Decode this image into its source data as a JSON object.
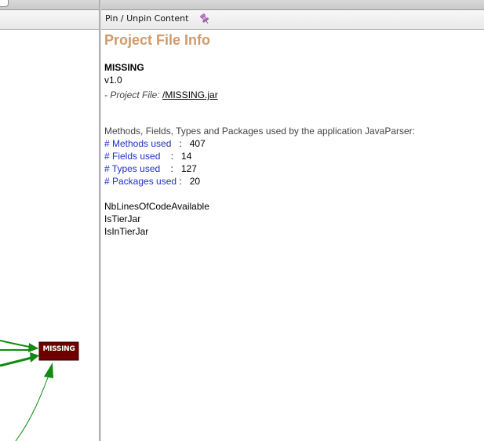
{
  "toolbar": {
    "pin_label": "Pin / Unpin Content",
    "pin_icon": "pushpin-icon"
  },
  "info": {
    "title": "Project File Info",
    "assembly_name": "MISSING",
    "version": "v1.0",
    "project_file_label": "- Project File: ",
    "project_file_link": "/MISSING.jar",
    "summary": "Methods, Fields, Types and Packages used by the application JavaParser:",
    "metrics": [
      {
        "label": "# Methods used",
        "sep": "   :   ",
        "value": "407"
      },
      {
        "label": "# Fields used",
        "sep": "    :   ",
        "value": "14"
      },
      {
        "label": "# Types used",
        "sep": "    :   ",
        "value": "127"
      },
      {
        "label": "# Packages used",
        "sep": " :   ",
        "value": "20"
      }
    ],
    "properties": [
      "NbLinesOfCodeAvailable",
      "IsTierJar",
      "IsInTierJar"
    ]
  },
  "graph": {
    "node_label": "MISSING",
    "node_color": "#6e0000",
    "edge_color": "#108a10"
  },
  "colors": {
    "title": "#d19a6a",
    "metric_label": "#1f2fc2"
  }
}
